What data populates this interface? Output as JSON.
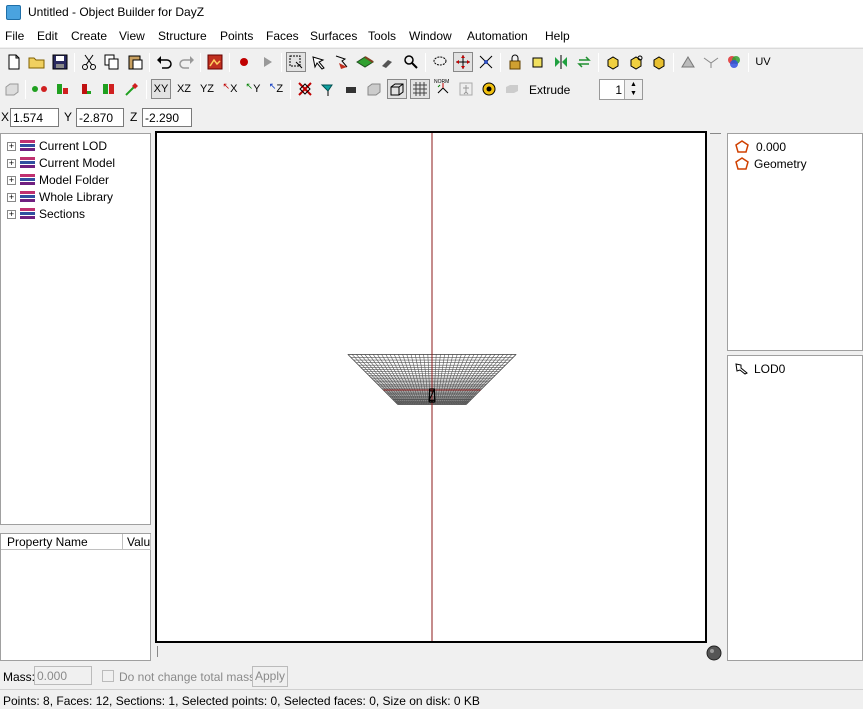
{
  "window": {
    "title": "Untitled - Object Builder for DayZ"
  },
  "menu": [
    "File",
    "Edit",
    "Create",
    "View",
    "Structure",
    "Points",
    "Faces",
    "Surfaces",
    "Tools",
    "Window",
    "Automation",
    "Help"
  ],
  "toolbar2": {
    "view_xy": "XY",
    "view_xz": "XZ",
    "view_yz": "YZ",
    "axis_x": "X",
    "axis_y": "Y",
    "axis_z": "Z",
    "norm_label": "NORM",
    "uv_label": "UV",
    "extrude_label": "Extrude",
    "extrude_value": "1"
  },
  "coords": {
    "x_label": "X",
    "x_value": "1.574",
    "y_label": "Y",
    "y_value": "-2.870",
    "z_label": "Z",
    "z_value": "-2.290"
  },
  "tree": {
    "items": [
      {
        "label": "Current LOD"
      },
      {
        "label": "Current Model"
      },
      {
        "label": "Model Folder"
      },
      {
        "label": "Whole Library"
      },
      {
        "label": "Sections"
      }
    ]
  },
  "properties": {
    "col_name": "Property Name",
    "col_value": "Valu"
  },
  "selections": {
    "value_item": "0.000",
    "geometry_item": "Geometry"
  },
  "lods": {
    "item": "LOD0"
  },
  "mass": {
    "label": "Mass:",
    "value": "0.000",
    "checkbox_label": "Do not change total mass",
    "apply_label": "Apply"
  },
  "status": {
    "text": "Points: 8, Faces: 12, Sections: 1, Selected points: 0, Selected faces: 0, Size on disk: 0 KB"
  },
  "colors": {
    "axis_red": "#8b1a1a",
    "grid": "#555555",
    "frame": "#000000"
  }
}
